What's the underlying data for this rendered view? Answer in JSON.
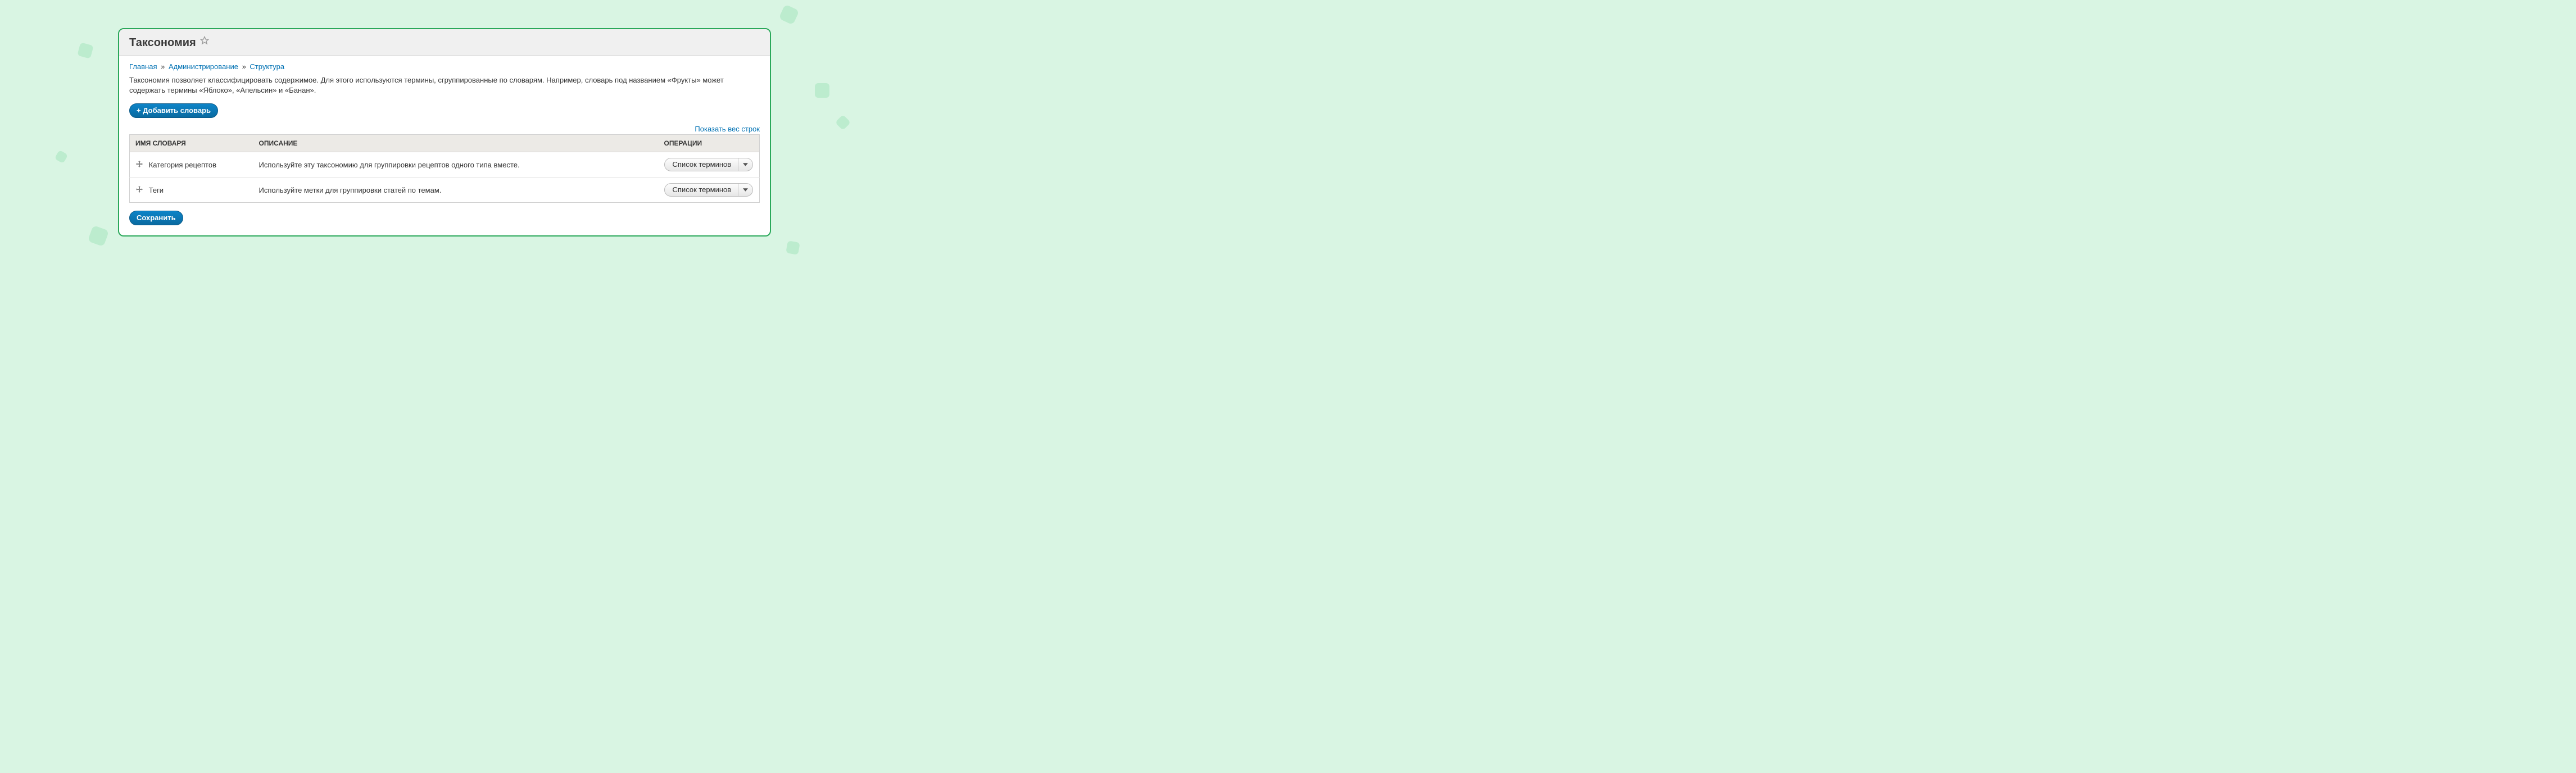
{
  "header": {
    "title": "Таксономия"
  },
  "breadcrumb": {
    "items": [
      {
        "label": "Главная"
      },
      {
        "label": "Администрирование"
      },
      {
        "label": "Структура"
      }
    ],
    "separator": "»"
  },
  "intro": "Таксономия позволяет классифицировать содержимое. Для этого используются термины, сгруппированные по словарям. Например, словарь под названием «Фрукты» может содержать термины «Яблоко», «Апельсин» и «Банан».",
  "buttons": {
    "add_vocabulary": "+ Добавить словарь",
    "save": "Сохранить"
  },
  "row_weights_toggle": "Показать вес строк",
  "table": {
    "columns": {
      "name": "ИМЯ СЛОВАРЯ",
      "description": "ОПИСАНИЕ",
      "operations": "ОПЕРАЦИИ"
    },
    "rows": [
      {
        "name": "Категория рецептов",
        "description": "Используйте эту таксономию для группировки рецептов одного типа вместе.",
        "operation": "Список терминов"
      },
      {
        "name": "Теги",
        "description": "Используйте метки для группировки статей по темам.",
        "operation": "Список терминов"
      }
    ]
  }
}
